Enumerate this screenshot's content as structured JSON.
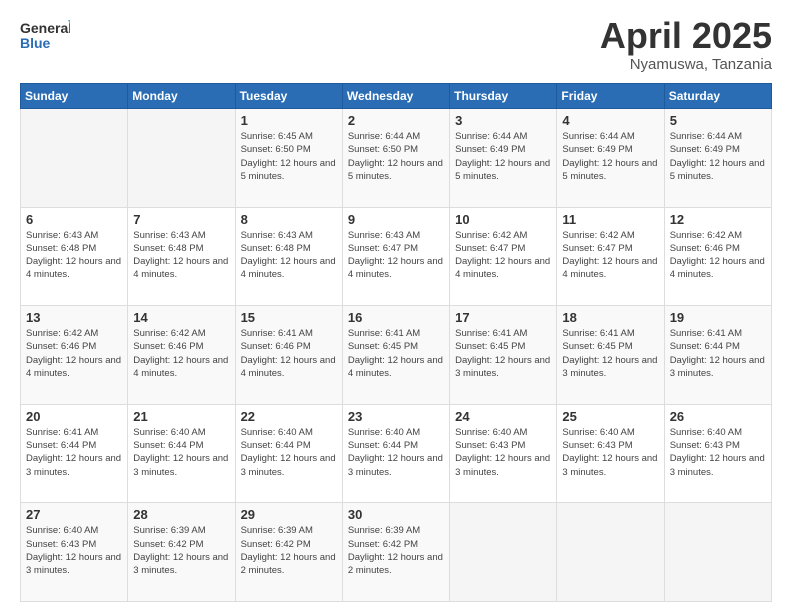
{
  "logo": {
    "general": "General",
    "blue": "Blue"
  },
  "header": {
    "title": "April 2025",
    "subtitle": "Nyamuswa, Tanzania"
  },
  "weekdays": [
    "Sunday",
    "Monday",
    "Tuesday",
    "Wednesday",
    "Thursday",
    "Friday",
    "Saturday"
  ],
  "weeks": [
    [
      {
        "day": "",
        "info": ""
      },
      {
        "day": "",
        "info": ""
      },
      {
        "day": "1",
        "info": "Sunrise: 6:45 AM\nSunset: 6:50 PM\nDaylight: 12 hours\nand 5 minutes."
      },
      {
        "day": "2",
        "info": "Sunrise: 6:44 AM\nSunset: 6:50 PM\nDaylight: 12 hours\nand 5 minutes."
      },
      {
        "day": "3",
        "info": "Sunrise: 6:44 AM\nSunset: 6:49 PM\nDaylight: 12 hours\nand 5 minutes."
      },
      {
        "day": "4",
        "info": "Sunrise: 6:44 AM\nSunset: 6:49 PM\nDaylight: 12 hours\nand 5 minutes."
      },
      {
        "day": "5",
        "info": "Sunrise: 6:44 AM\nSunset: 6:49 PM\nDaylight: 12 hours\nand 5 minutes."
      }
    ],
    [
      {
        "day": "6",
        "info": "Sunrise: 6:43 AM\nSunset: 6:48 PM\nDaylight: 12 hours\nand 4 minutes."
      },
      {
        "day": "7",
        "info": "Sunrise: 6:43 AM\nSunset: 6:48 PM\nDaylight: 12 hours\nand 4 minutes."
      },
      {
        "day": "8",
        "info": "Sunrise: 6:43 AM\nSunset: 6:48 PM\nDaylight: 12 hours\nand 4 minutes."
      },
      {
        "day": "9",
        "info": "Sunrise: 6:43 AM\nSunset: 6:47 PM\nDaylight: 12 hours\nand 4 minutes."
      },
      {
        "day": "10",
        "info": "Sunrise: 6:42 AM\nSunset: 6:47 PM\nDaylight: 12 hours\nand 4 minutes."
      },
      {
        "day": "11",
        "info": "Sunrise: 6:42 AM\nSunset: 6:47 PM\nDaylight: 12 hours\nand 4 minutes."
      },
      {
        "day": "12",
        "info": "Sunrise: 6:42 AM\nSunset: 6:46 PM\nDaylight: 12 hours\nand 4 minutes."
      }
    ],
    [
      {
        "day": "13",
        "info": "Sunrise: 6:42 AM\nSunset: 6:46 PM\nDaylight: 12 hours\nand 4 minutes."
      },
      {
        "day": "14",
        "info": "Sunrise: 6:42 AM\nSunset: 6:46 PM\nDaylight: 12 hours\nand 4 minutes."
      },
      {
        "day": "15",
        "info": "Sunrise: 6:41 AM\nSunset: 6:46 PM\nDaylight: 12 hours\nand 4 minutes."
      },
      {
        "day": "16",
        "info": "Sunrise: 6:41 AM\nSunset: 6:45 PM\nDaylight: 12 hours\nand 4 minutes."
      },
      {
        "day": "17",
        "info": "Sunrise: 6:41 AM\nSunset: 6:45 PM\nDaylight: 12 hours\nand 3 minutes."
      },
      {
        "day": "18",
        "info": "Sunrise: 6:41 AM\nSunset: 6:45 PM\nDaylight: 12 hours\nand 3 minutes."
      },
      {
        "day": "19",
        "info": "Sunrise: 6:41 AM\nSunset: 6:44 PM\nDaylight: 12 hours\nand 3 minutes."
      }
    ],
    [
      {
        "day": "20",
        "info": "Sunrise: 6:41 AM\nSunset: 6:44 PM\nDaylight: 12 hours\nand 3 minutes."
      },
      {
        "day": "21",
        "info": "Sunrise: 6:40 AM\nSunset: 6:44 PM\nDaylight: 12 hours\nand 3 minutes."
      },
      {
        "day": "22",
        "info": "Sunrise: 6:40 AM\nSunset: 6:44 PM\nDaylight: 12 hours\nand 3 minutes."
      },
      {
        "day": "23",
        "info": "Sunrise: 6:40 AM\nSunset: 6:44 PM\nDaylight: 12 hours\nand 3 minutes."
      },
      {
        "day": "24",
        "info": "Sunrise: 6:40 AM\nSunset: 6:43 PM\nDaylight: 12 hours\nand 3 minutes."
      },
      {
        "day": "25",
        "info": "Sunrise: 6:40 AM\nSunset: 6:43 PM\nDaylight: 12 hours\nand 3 minutes."
      },
      {
        "day": "26",
        "info": "Sunrise: 6:40 AM\nSunset: 6:43 PM\nDaylight: 12 hours\nand 3 minutes."
      }
    ],
    [
      {
        "day": "27",
        "info": "Sunrise: 6:40 AM\nSunset: 6:43 PM\nDaylight: 12 hours\nand 3 minutes."
      },
      {
        "day": "28",
        "info": "Sunrise: 6:39 AM\nSunset: 6:42 PM\nDaylight: 12 hours\nand 3 minutes."
      },
      {
        "day": "29",
        "info": "Sunrise: 6:39 AM\nSunset: 6:42 PM\nDaylight: 12 hours\nand 2 minutes."
      },
      {
        "day": "30",
        "info": "Sunrise: 6:39 AM\nSunset: 6:42 PM\nDaylight: 12 hours\nand 2 minutes."
      },
      {
        "day": "",
        "info": ""
      },
      {
        "day": "",
        "info": ""
      },
      {
        "day": "",
        "info": ""
      }
    ]
  ]
}
